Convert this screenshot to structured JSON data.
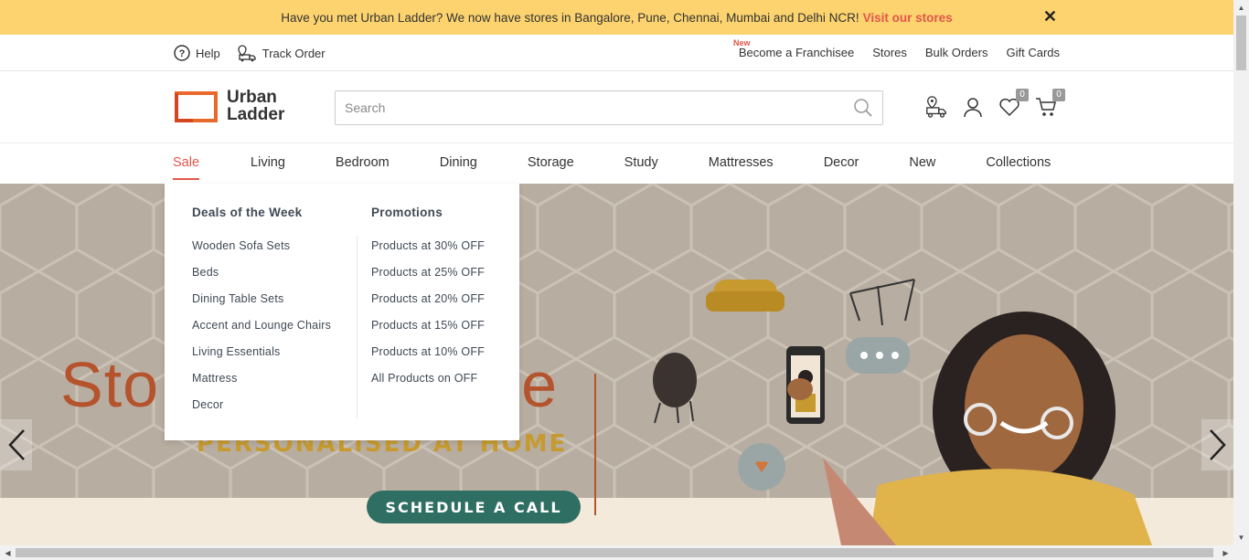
{
  "announcement": {
    "text": "Have you met Urban Ladder? We now have stores in Bangalore, Pune, Chennai, Mumbai and Delhi NCR!",
    "link": "Visit our stores",
    "close": "✕"
  },
  "utility": {
    "help": "Help",
    "track_order": "Track Order",
    "new_tag": "New",
    "right": [
      "Become a Franchisee",
      "Stores",
      "Bulk Orders",
      "Gift Cards"
    ]
  },
  "logo": {
    "line1": "Urban",
    "line2": "Ladder"
  },
  "search": {
    "placeholder": "Search"
  },
  "header_icons": {
    "wishlist_count": "0",
    "cart_count": "0"
  },
  "nav": {
    "items": [
      "Sale",
      "Living",
      "Bedroom",
      "Dining",
      "Storage",
      "Study",
      "Mattresses",
      "Decor",
      "New",
      "Collections"
    ],
    "active": "Sale"
  },
  "dropdown": {
    "col1_title": "Deals of the Week",
    "col1": [
      "Wooden Sofa Sets",
      "Beds",
      "Dining Table Sets",
      "Accent and Lounge Chairs",
      "Living Essentials",
      "Mattress",
      "Decor"
    ],
    "col2_title": "Promotions",
    "col2": [
      "Products at 30% OFF",
      "Products at 25% OFF",
      "Products at 20% OFF",
      "Products at 15% OFF",
      "Products at 10% OFF",
      "All Products on OFF"
    ]
  },
  "hero": {
    "title_visible": "Sto",
    "title_tail": "ce",
    "subtitle": "PERSONALISED AT HOME",
    "cta": "SCHEDULE A CALL"
  },
  "colors": {
    "accent": "#e2564a",
    "banner": "#fcd36e",
    "cta": "#2f6e63",
    "hero_bg": "#b8ada1"
  }
}
